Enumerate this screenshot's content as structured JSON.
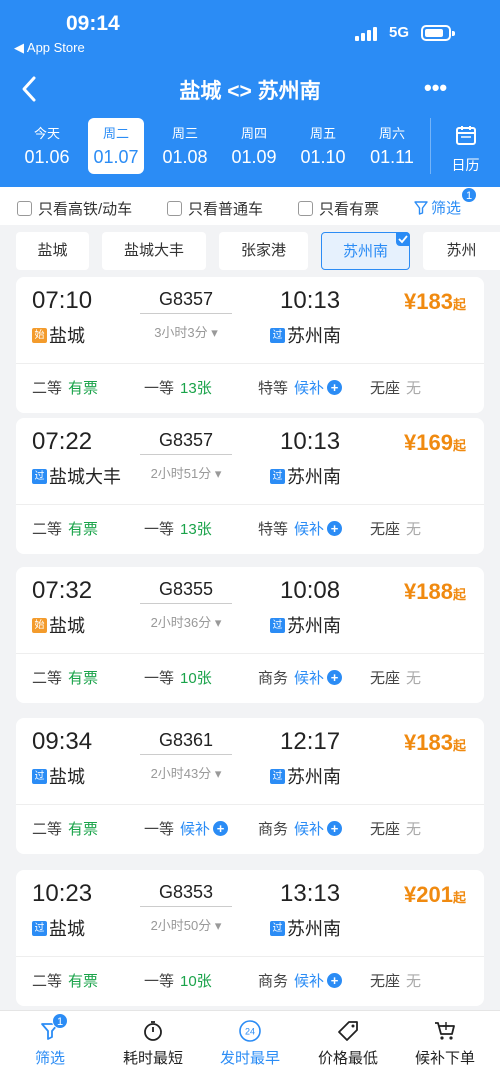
{
  "status": {
    "time": "09:14",
    "back_app": "◀ App Store",
    "network": "5G"
  },
  "nav": {
    "title": "盐城 <> 苏州南",
    "more": "•••"
  },
  "dates": [
    {
      "weekday": "今天",
      "date": "01.06"
    },
    {
      "weekday": "周二",
      "date": "01.07",
      "active": true
    },
    {
      "weekday": "周三",
      "date": "01.08"
    },
    {
      "weekday": "周四",
      "date": "01.09"
    },
    {
      "weekday": "周五",
      "date": "01.10"
    },
    {
      "weekday": "周六",
      "date": "01.11"
    }
  ],
  "calendar_label": "日历",
  "filters": {
    "hsr_only": "只看高铁/动车",
    "normal_only": "只看普通车",
    "available_only": "只看有票",
    "filter_label": "筛选",
    "filter_badge": "1"
  },
  "stations": [
    "盐城",
    "盐城大丰",
    "张家港",
    "苏州南",
    "苏州"
  ],
  "trains": [
    {
      "dep": "07:10",
      "no": "G8357",
      "arr": "10:13",
      "price": "¥183",
      "price_suffix": "起",
      "duration": "3小时3分",
      "from_tag": "始",
      "from": "盐城",
      "to_tag": "过",
      "to": "苏州南",
      "seats": [
        {
          "cls": "二等",
          "val": "有票",
          "color": "green"
        },
        {
          "cls": "一等",
          "val": "13张",
          "color": "green"
        },
        {
          "cls": "特等",
          "val": "候补",
          "color": "blue",
          "plus": true
        },
        {
          "cls": "无座",
          "val": "无",
          "color": "gray"
        }
      ]
    },
    {
      "dep": "07:22",
      "no": "G8357",
      "arr": "10:13",
      "price": "¥169",
      "price_suffix": "起",
      "duration": "2小时51分",
      "from_tag": "过",
      "from": "盐城大丰",
      "to_tag": "过",
      "to": "苏州南",
      "seats": [
        {
          "cls": "二等",
          "val": "有票",
          "color": "green"
        },
        {
          "cls": "一等",
          "val": "13张",
          "color": "green"
        },
        {
          "cls": "特等",
          "val": "候补",
          "color": "blue",
          "plus": true
        },
        {
          "cls": "无座",
          "val": "无",
          "color": "gray"
        }
      ]
    },
    {
      "dep": "07:32",
      "no": "G8355",
      "arr": "10:08",
      "price": "¥188",
      "price_suffix": "起",
      "duration": "2小时36分",
      "from_tag": "始",
      "from": "盐城",
      "to_tag": "过",
      "to": "苏州南",
      "seats": [
        {
          "cls": "二等",
          "val": "有票",
          "color": "green"
        },
        {
          "cls": "一等",
          "val": "10张",
          "color": "green"
        },
        {
          "cls": "商务",
          "val": "候补",
          "color": "blue",
          "plus": true
        },
        {
          "cls": "无座",
          "val": "无",
          "color": "gray"
        }
      ]
    },
    {
      "dep": "09:34",
      "no": "G8361",
      "arr": "12:17",
      "price": "¥183",
      "price_suffix": "起",
      "duration": "2小时43分",
      "from_tag": "过",
      "from": "盐城",
      "to_tag": "过",
      "to": "苏州南",
      "seats": [
        {
          "cls": "二等",
          "val": "有票",
          "color": "green"
        },
        {
          "cls": "一等",
          "val": "候补",
          "color": "blue",
          "plus": true
        },
        {
          "cls": "商务",
          "val": "候补",
          "color": "blue",
          "plus": true
        },
        {
          "cls": "无座",
          "val": "无",
          "color": "gray"
        }
      ]
    },
    {
      "dep": "10:23",
      "no": "G8353",
      "arr": "13:13",
      "price": "¥201",
      "price_suffix": "起",
      "duration": "2小时50分",
      "from_tag": "过",
      "from": "盐城",
      "to_tag": "过",
      "to": "苏州南",
      "seats": [
        {
          "cls": "二等",
          "val": "有票",
          "color": "green"
        },
        {
          "cls": "一等",
          "val": "10张",
          "color": "green"
        },
        {
          "cls": "商务",
          "val": "候补",
          "color": "blue",
          "plus": true
        },
        {
          "cls": "无座",
          "val": "无",
          "color": "gray"
        }
      ]
    }
  ],
  "bottom": [
    {
      "label": "筛选",
      "icon": "filter-icon",
      "badge": "1"
    },
    {
      "label": "耗时最短",
      "icon": "stopwatch-icon"
    },
    {
      "label": "发时最早",
      "icon": "clock-24-icon",
      "badge_text": "24"
    },
    {
      "label": "价格最低",
      "icon": "price-tag-icon"
    },
    {
      "label": "候补下单",
      "icon": "cart-icon"
    }
  ],
  "colors": {
    "primary": "#2b8cf5",
    "price": "#f08a10",
    "available": "#1aa34a"
  }
}
